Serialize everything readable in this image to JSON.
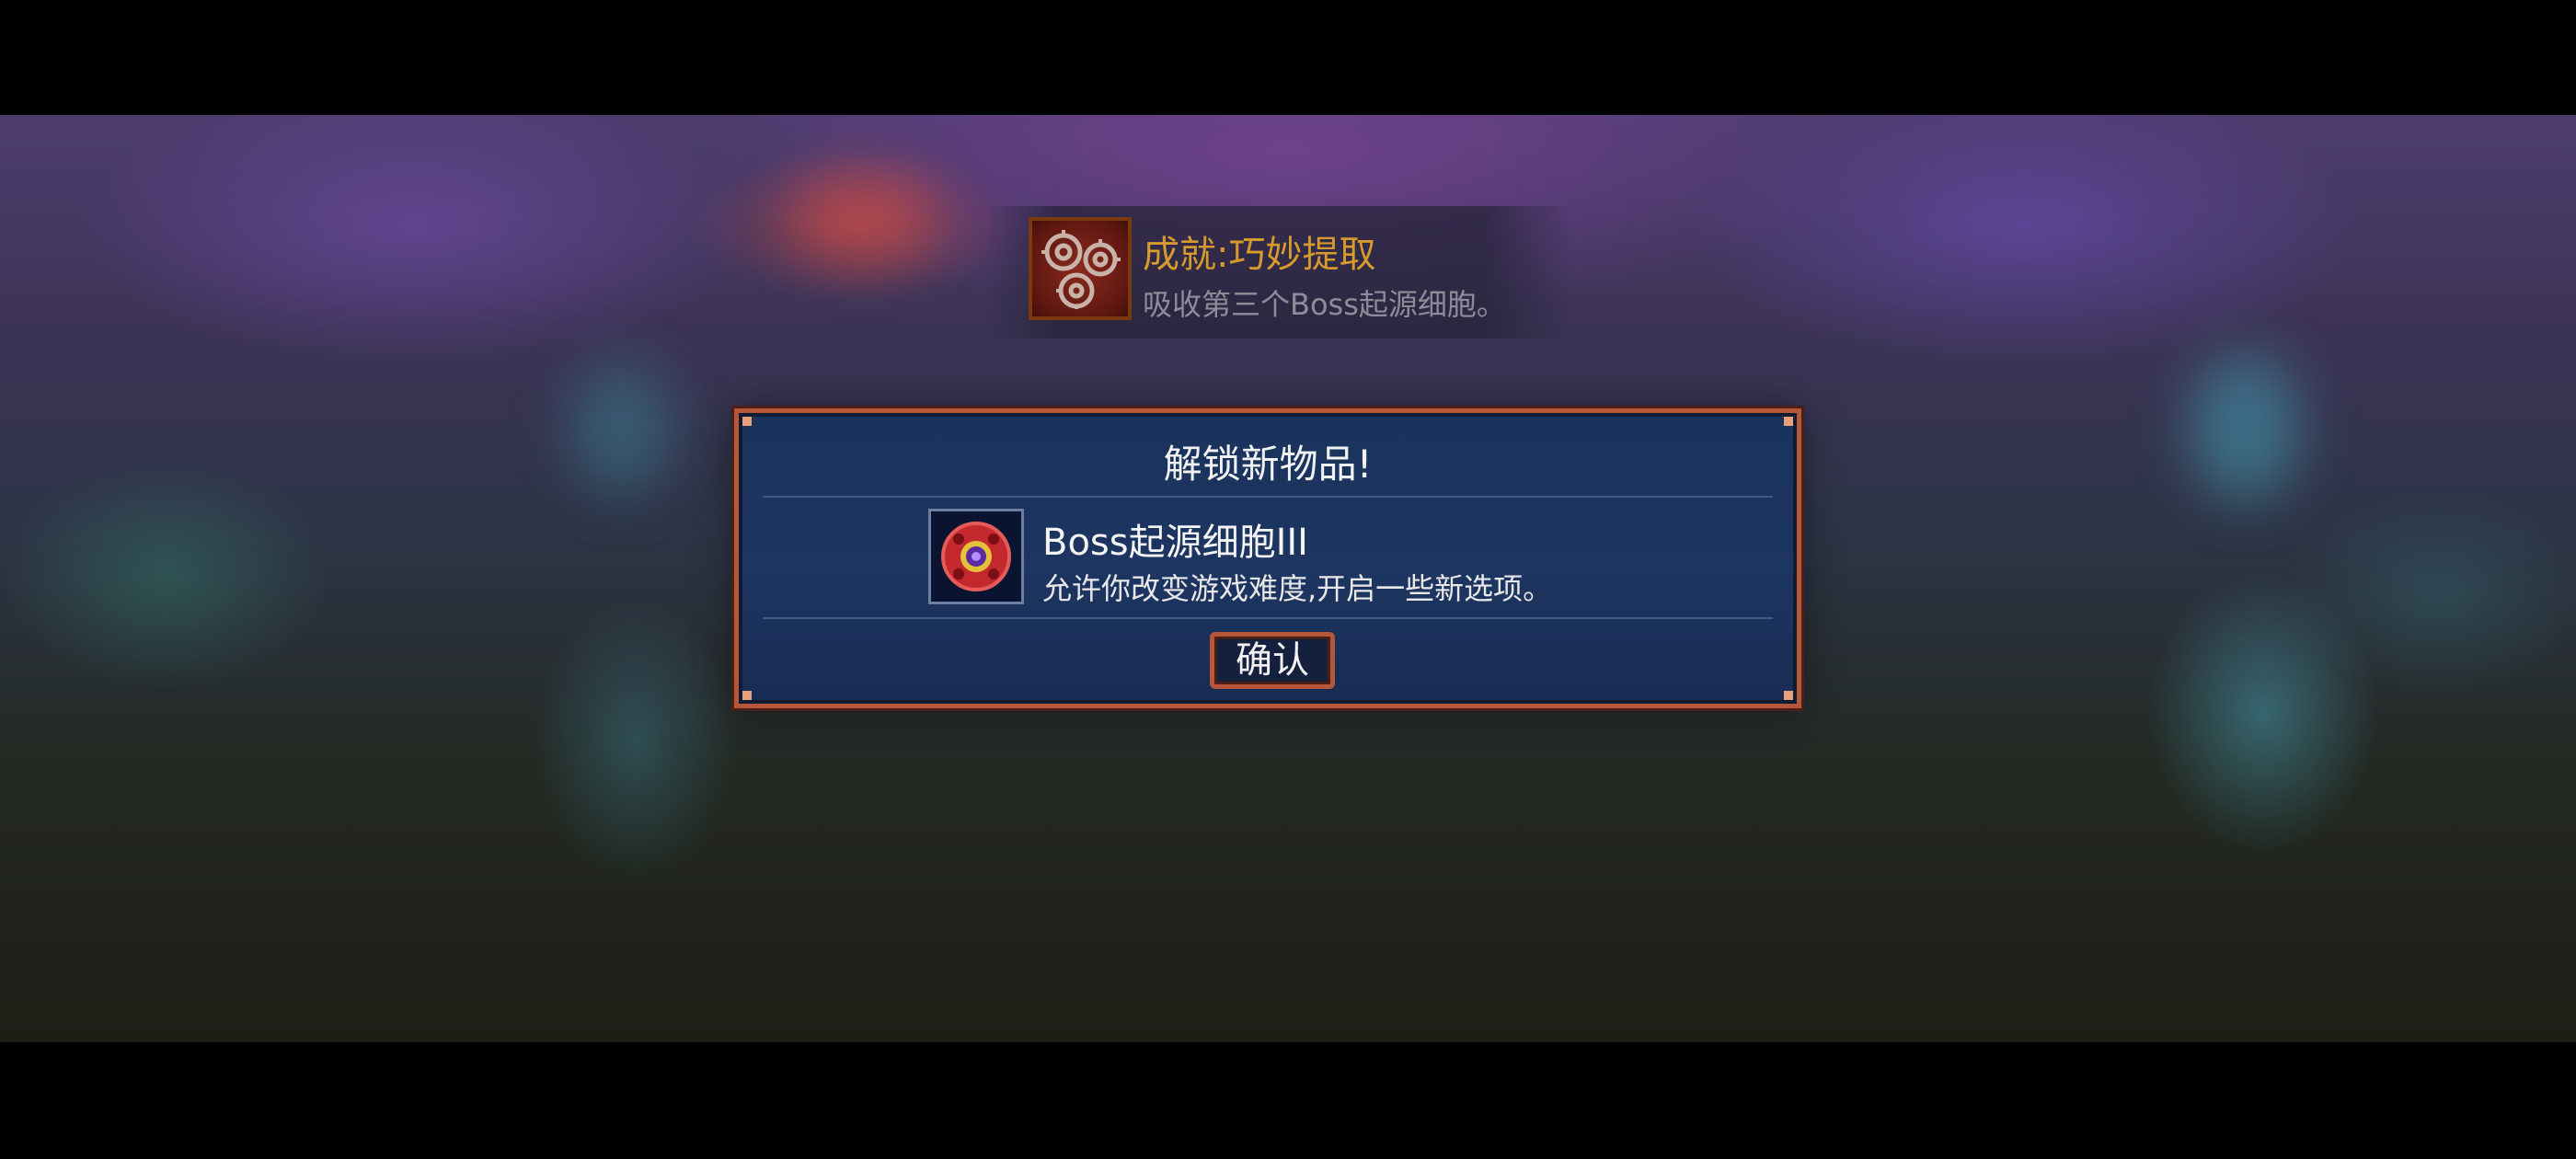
{
  "achievement": {
    "title": "成就:巧妙提取",
    "description": "吸收第三个Boss起源细胞。",
    "icon": "gears-achievement-icon"
  },
  "unlock_dialog": {
    "title": "解锁新物品!",
    "item": {
      "name": "Boss起源细胞III",
      "description": "允许你改变游戏难度,开启一些新选项。",
      "icon": "boss-cell-icon"
    },
    "confirm_label": "确认"
  },
  "colors": {
    "achievement_title": "#d79a2c",
    "dialog_border": "#b6573a",
    "dialog_background": "#1a335c"
  }
}
